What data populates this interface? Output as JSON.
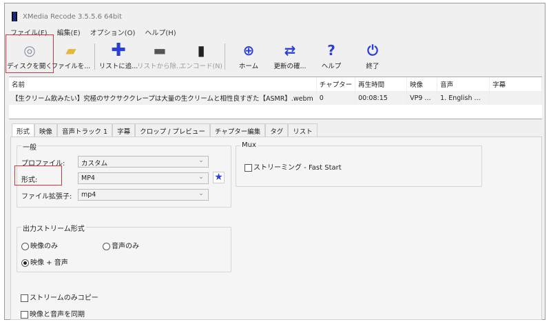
{
  "title": "XMedia Recode 3.5.5.6 64bit",
  "menu": [
    "ファイル(F)",
    "編集(E)",
    "オプション(O)",
    "ヘルプ(H)"
  ],
  "toolbar": [
    {
      "label": "ディスクを開く",
      "icon": "disc-icon"
    },
    {
      "label": "ファイルを...",
      "icon": "folder-open-icon"
    },
    {
      "label": "リストに追...",
      "icon": "plus-icon"
    },
    {
      "label": "リストから除...",
      "icon": "minus-icon"
    },
    {
      "label": "エンコード(N)",
      "icon": "encode-icon"
    },
    {
      "label": "ホーム",
      "icon": "globe-icon"
    },
    {
      "label": "更新の確...",
      "icon": "refresh-icon"
    },
    {
      "label": "ヘルプ",
      "icon": "question-icon"
    },
    {
      "label": "終了",
      "icon": "power-icon"
    }
  ],
  "list": {
    "headers": [
      "名前",
      "チャプター",
      "再生時間",
      "映像",
      "音声",
      "字幕"
    ],
    "rows": [
      [
        "【生クリーム飲みたい】究極のサクサククレープは大量の生クリームと相性良すぎた【ASMR】.webm",
        "0",
        "00:08:15",
        "VP9 ...",
        "1. English ...",
        ""
      ]
    ]
  },
  "tabs": [
    "形式",
    "映像",
    "音声トラック 1",
    "字幕",
    "クロップ / プレビュー",
    "チャプター編集",
    "タグ",
    "リスト"
  ],
  "general": {
    "title": "一般",
    "profile_label": "プロファイル:",
    "profile_value": "カスタム",
    "format_label": "形式:",
    "format_value": "MP4",
    "ext_label": "ファイル拡張子:",
    "ext_value": "mp4"
  },
  "mux": {
    "title": "Mux",
    "streaming": "ストリーミング - Fast Start"
  },
  "output": {
    "title": "出力ストリーム形式",
    "video_only": "映像のみ",
    "audio_only": "音声のみ",
    "video_audio": "映像 + 音声"
  },
  "stream_copy": "ストリームのみコピー",
  "sync": "映像と音声を同期",
  "colors": {
    "accent": "#2a3fd8",
    "highlight": "#d9303a"
  }
}
